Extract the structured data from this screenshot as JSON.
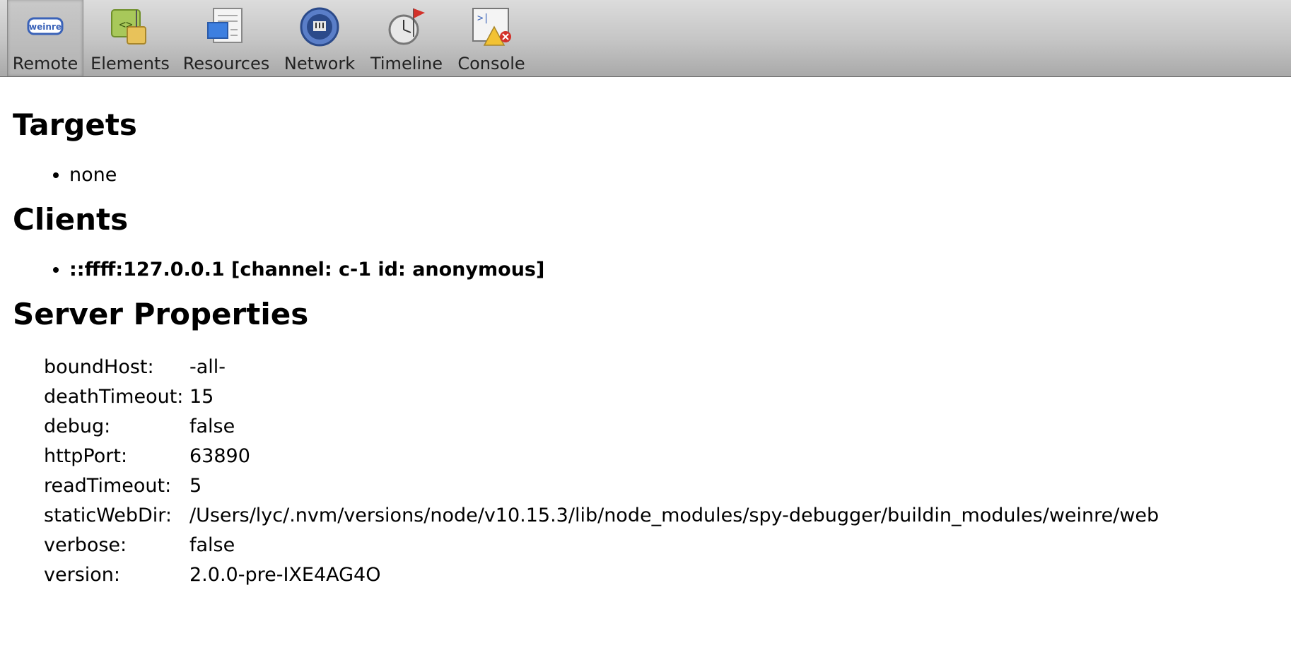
{
  "toolbar": {
    "items": [
      {
        "label": "Remote",
        "icon": "weinre-logo-icon",
        "selected": true
      },
      {
        "label": "Elements",
        "icon": "elements-icon"
      },
      {
        "label": "Resources",
        "icon": "resources-icon"
      },
      {
        "label": "Network",
        "icon": "network-icon"
      },
      {
        "label": "Timeline",
        "icon": "timeline-icon"
      },
      {
        "label": "Console",
        "icon": "console-icon"
      }
    ],
    "logo_text": "weinre"
  },
  "sections": {
    "targets": {
      "title": "Targets",
      "items": [
        "none"
      ]
    },
    "clients": {
      "title": "Clients",
      "items": [
        "::ffff:127.0.0.1 [channel: c-1 id: anonymous]"
      ]
    },
    "server_properties": {
      "title": "Server Properties",
      "rows": [
        {
          "key": "boundHost:",
          "value": "-all-"
        },
        {
          "key": "deathTimeout:",
          "value": "15"
        },
        {
          "key": "debug:",
          "value": "false"
        },
        {
          "key": "httpPort:",
          "value": "63890"
        },
        {
          "key": "readTimeout:",
          "value": "5"
        },
        {
          "key": "staticWebDir:",
          "value": "/Users/lyc/.nvm/versions/node/v10.15.3/lib/node_modules/spy-debugger/buildin_modules/weinre/web"
        },
        {
          "key": "verbose:",
          "value": "false"
        },
        {
          "key": "version:",
          "value": "2.0.0-pre-IXE4AG4O"
        }
      ]
    }
  }
}
